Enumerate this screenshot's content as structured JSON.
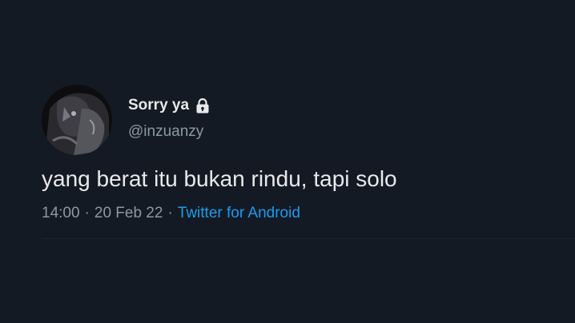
{
  "tweet": {
    "author": {
      "display_name": "Sorry ya",
      "handle": "@inzuanzy",
      "protected_icon": "lock-icon"
    },
    "text": "yang berat itu bukan rindu, tapi solo",
    "time": "14:00",
    "separator": "·",
    "date": "20 Feb 22",
    "source": "Twitter for Android"
  },
  "colors": {
    "background": "#141a23",
    "primary_text": "#e7e9ea",
    "secondary_text": "#8b98a5",
    "link": "#1d9bf0"
  }
}
